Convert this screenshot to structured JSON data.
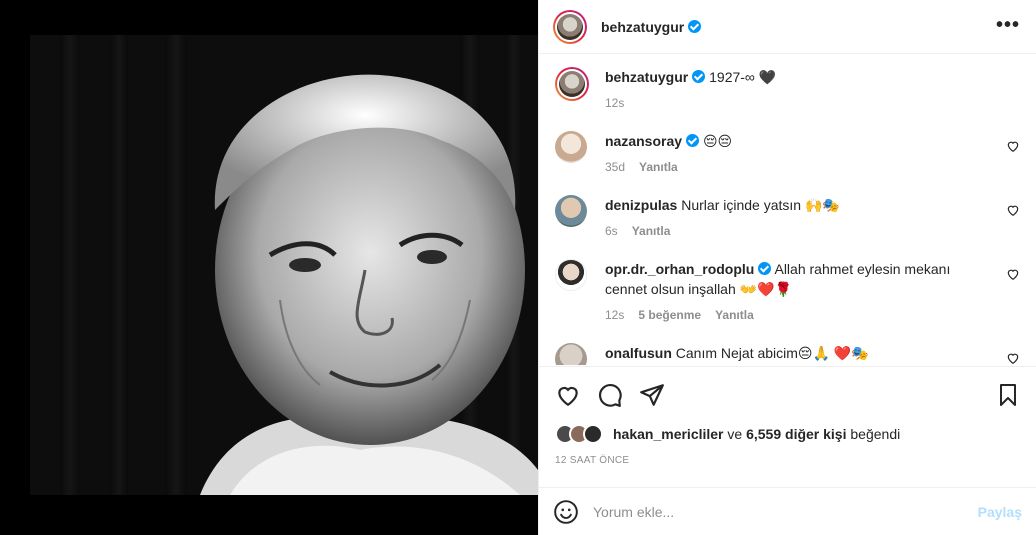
{
  "post": {
    "username": "behzatuygur",
    "caption_user": "behzatuygur",
    "caption_text": "1927-∞ 🖤",
    "caption_time": "12s"
  },
  "comments": [
    {
      "user": "nazansoray",
      "verified": true,
      "text": "😔😔",
      "time": "35d",
      "likes": "",
      "reply": "Yanıtla"
    },
    {
      "user": "denizpulas",
      "verified": false,
      "text": "Nurlar içinde yatsın 🙌🎭",
      "time": "6s",
      "likes": "",
      "reply": "Yanıtla"
    },
    {
      "user": "opr.dr._orhan_rodoplu",
      "verified": true,
      "text": "Allah rahmet eylesin mekanı cennet olsun inşallah 👐❤️🌹",
      "time": "12s",
      "likes": "5 beğenme",
      "reply": "Yanıtla"
    },
    {
      "user": "onalfusun",
      "verified": false,
      "text": "Canım Nejat abicim😔🙏 ❤️🎭",
      "time": "",
      "likes": "",
      "reply": ""
    }
  ],
  "likes": {
    "first_user": "hakan_mericliler",
    "connector": "ve",
    "others": "6,559 diğer kişi",
    "suffix": "beğendi"
  },
  "timestamp": "12 SAAT ÖNCE",
  "add_comment": {
    "placeholder": "Yorum ekle...",
    "post_label": "Paylaş"
  },
  "colors": {
    "verified": "#0095f6",
    "muted": "#8e8e8e",
    "post_disabled": "#b2dffc"
  },
  "icons": [
    "more-options-icon",
    "heart-icon",
    "comment-icon",
    "share-icon",
    "bookmark-icon",
    "emoji-icon",
    "verified-icon"
  ]
}
